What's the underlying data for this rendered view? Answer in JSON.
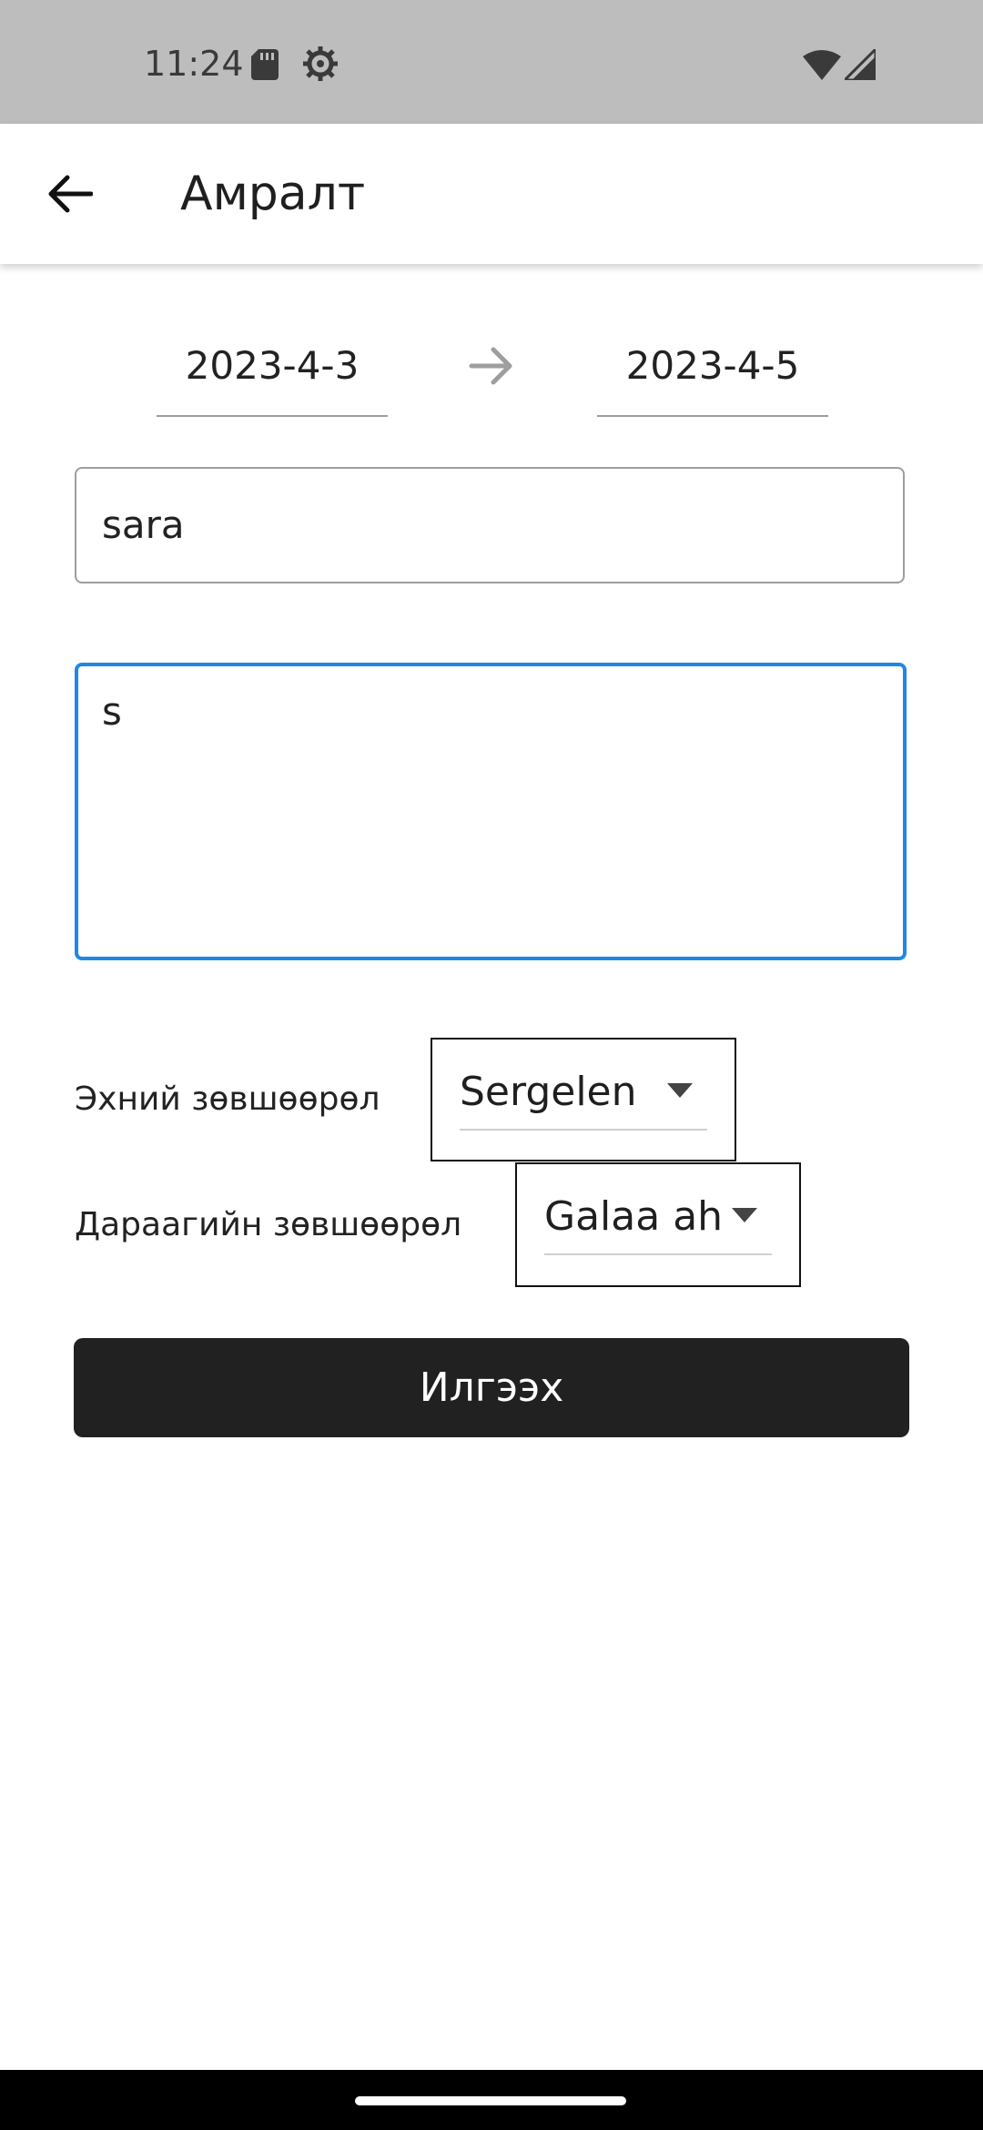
{
  "status_bar": {
    "time": "11:24",
    "icons": [
      "sd-card-icon",
      "settings-icon",
      "wifi-icon",
      "signal-icon"
    ]
  },
  "app_bar": {
    "title": "Амралт",
    "back_icon": "arrow-back-icon"
  },
  "form": {
    "start_date": "2023-4-3",
    "end_date": "2023-4-5",
    "range_icon": "arrow-right-icon",
    "name_value": "sara",
    "reason_value": "s",
    "first_approval": {
      "label": "Эхний зөвшөөрөл",
      "selected": "Sergelen"
    },
    "next_approval": {
      "label": "Дараагийн зөвшөөрөл",
      "selected": "Galaa ah"
    },
    "submit_label": "Илгээх"
  },
  "colors": {
    "status_bar": "#bdbdbd",
    "focus_border": "#1e88e5",
    "button_bg": "#212121",
    "button_text": "#ffffff"
  }
}
